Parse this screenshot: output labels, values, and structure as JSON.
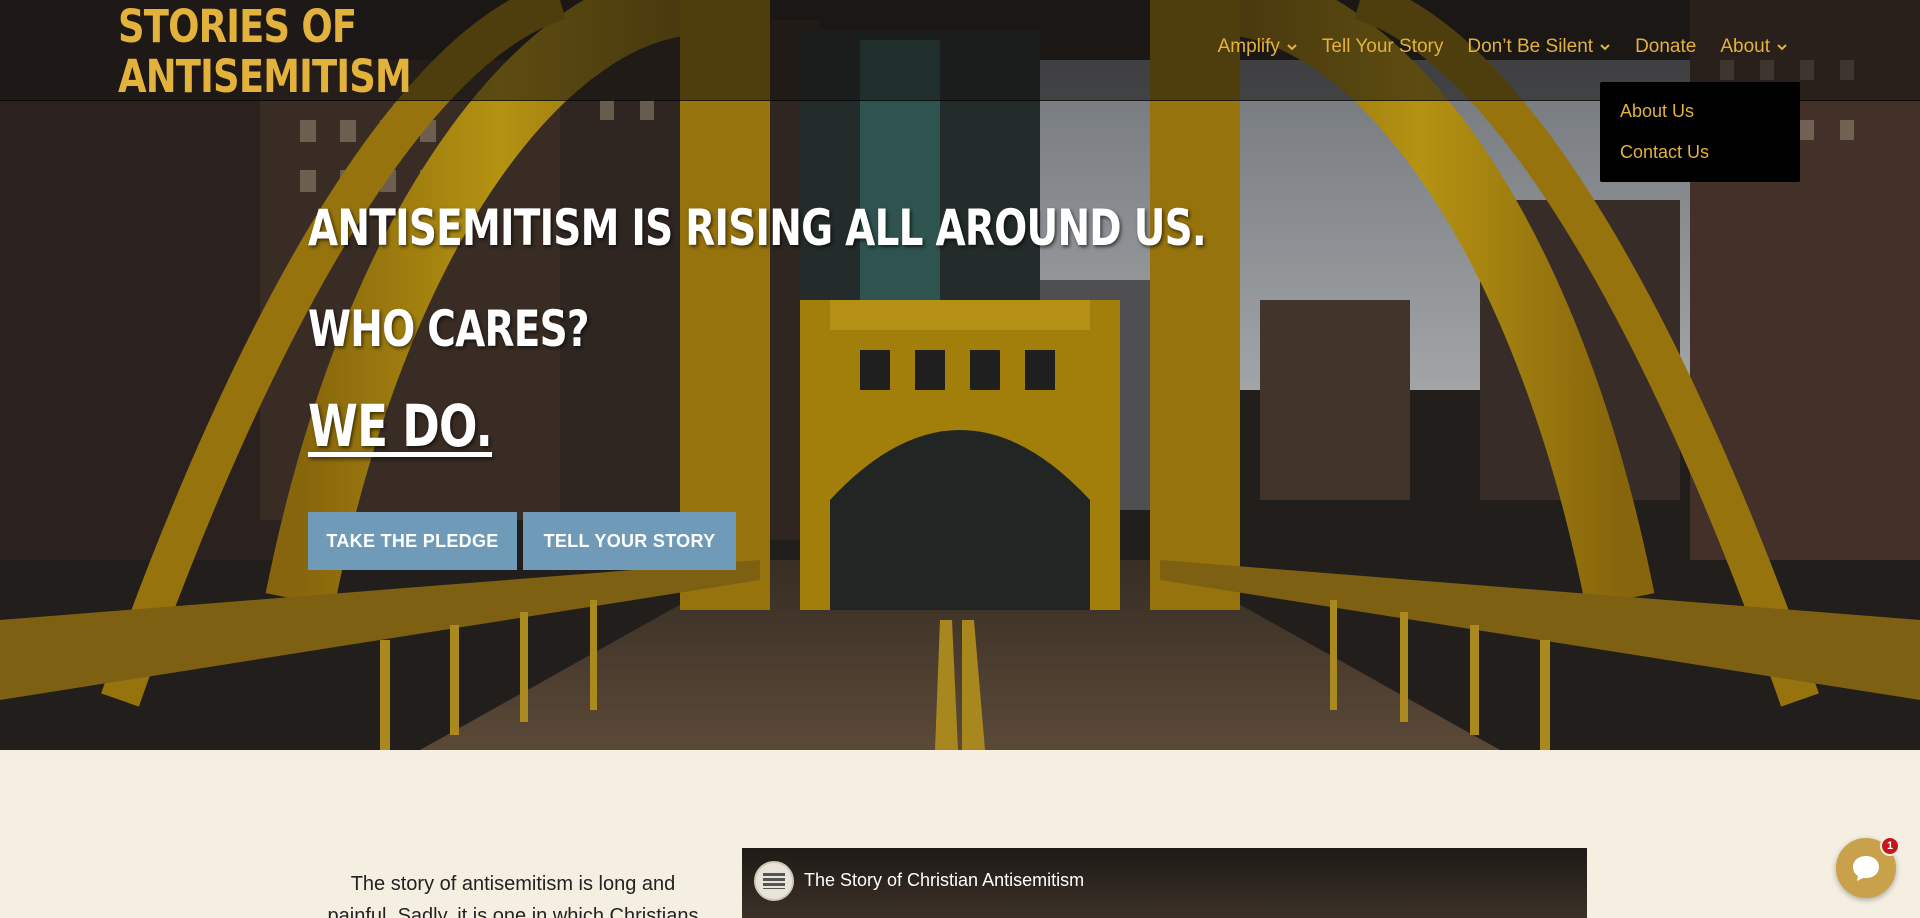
{
  "brand": {
    "line1": "STORIES OF",
    "line2": "ANTISEMITISM",
    "color": "#e3b23c"
  },
  "nav": {
    "items": [
      {
        "label": "Amplify",
        "has_dropdown": true
      },
      {
        "label": "Tell Your Story",
        "has_dropdown": false
      },
      {
        "label": "Don’t Be Silent",
        "has_dropdown": true
      },
      {
        "label": "Donate",
        "has_dropdown": false
      },
      {
        "label": "About",
        "has_dropdown": true
      }
    ],
    "about_menu": [
      "About Us",
      "Contact Us"
    ]
  },
  "hero": {
    "line1": "ANTISEMITISM IS RISING ALL AROUND US.",
    "line2": "WHO CARES?",
    "line3": "WE DO.",
    "buttons": {
      "pledge": "TAKE THE PLEDGE",
      "story": "TELL YOUR STORY"
    },
    "button_color": "#6f9bb8"
  },
  "content": {
    "text": "The story of antisemitism is long and painful. Sadly, it is one in which Christians",
    "video": {
      "title": "The Story of Christian Antisemitism",
      "channel_icon": "antisemitism-channel-icon"
    }
  },
  "chat": {
    "icon": "chat-bubble-icon",
    "badge": "1"
  }
}
